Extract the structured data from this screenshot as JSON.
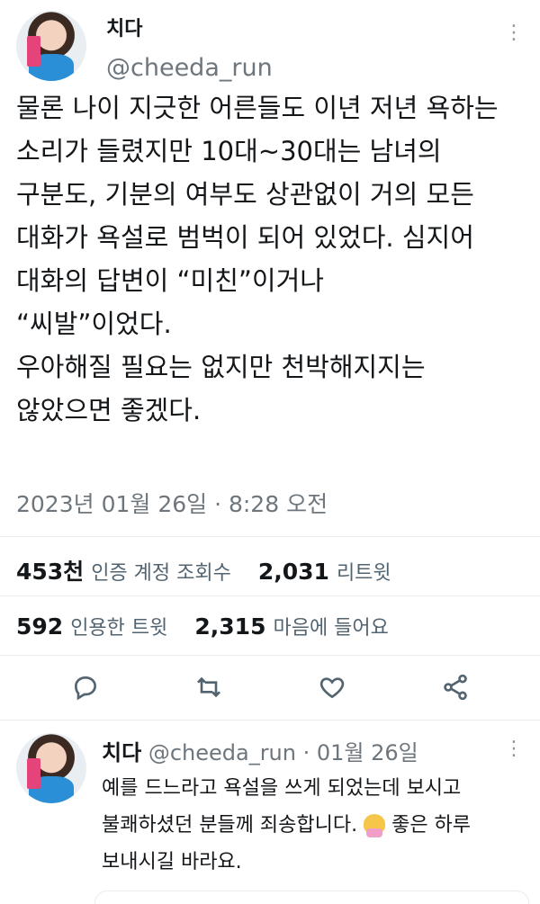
{
  "tweet": {
    "author_name": "치다",
    "handle": "@cheeda_run",
    "more_icon": "more-dots-icon",
    "text": "물론 나이 지긋한 어른들도 이년 저년 욕하는\n소리가 들렸지만 10대~30대는 남녀의\n구분도, 기분의 여부도 상관없이 거의 모든\n대화가 욕설로 범벅이 되어 있었다. 심지어\n대화의 답변이 “미친”이거나\n“씨발”이었다.\n우아해질 필요는 없지만 천박해지지는\n않았으면 좋겠다.",
    "timestamp": "2023년 01월 26일 · 8:28 오전"
  },
  "stats": {
    "views_count": "453천",
    "views_label": "인증 계정 조회수",
    "retweets_count": "2,031",
    "retweets_label": "리트윗",
    "quotes_count": "592",
    "quotes_label": "인용한 트윗",
    "likes_count": "2,315",
    "likes_label": "마음에 들어요"
  },
  "actions": [
    "reply-icon",
    "retweet-icon",
    "like-icon",
    "share-icon"
  ],
  "reply": {
    "author_name": "치다",
    "handle_date": "@cheeda_run · 01월 26일",
    "text_before_emoji": "예를 드느라고 욕설을 쓰게 되었는데 보시고\n불쾌하셨던 분들께 죄송합니다. ",
    "emoji": "person-bowing-emoji",
    "text_after_emoji": " 좋은 하루\n보내시길 바라요."
  }
}
